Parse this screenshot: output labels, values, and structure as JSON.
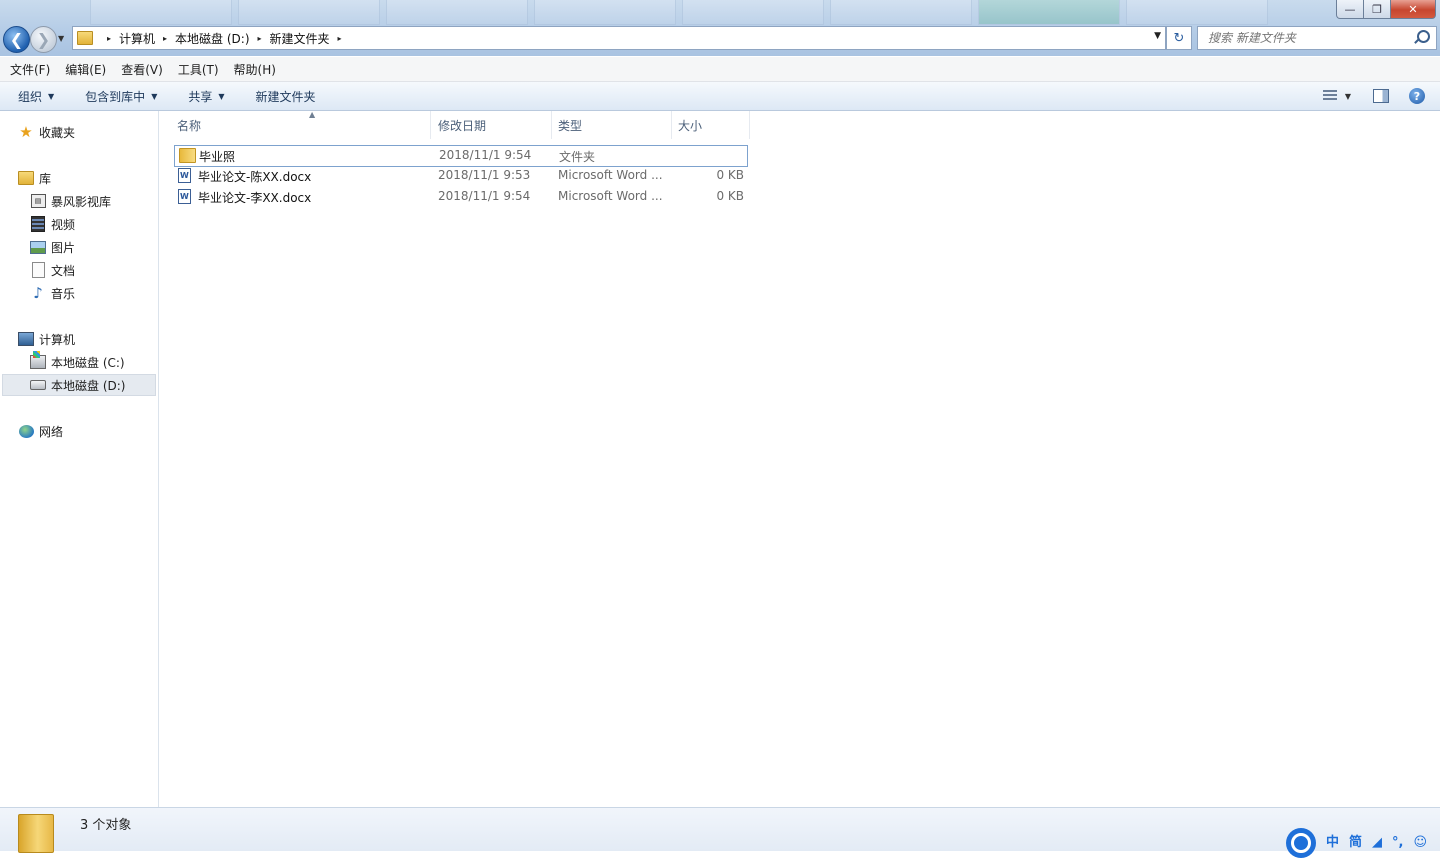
{
  "window": {
    "controls": {
      "minimize": "—",
      "maximize": "❐",
      "close": "✕"
    }
  },
  "nav": {
    "back_glyph": "❮",
    "forward_glyph": "❯",
    "history_glyph": "▼"
  },
  "address": {
    "segments": [
      "计算机",
      "本地磁盘 (D:)",
      "新建文件夹"
    ],
    "separator": "▸",
    "dropdown_glyph": "▼",
    "refresh_glyph": "↻"
  },
  "search": {
    "placeholder": "搜索 新建文件夹"
  },
  "menu": [
    "文件(F)",
    "编辑(E)",
    "查看(V)",
    "工具(T)",
    "帮助(H)"
  ],
  "toolbar": {
    "organize": "组织",
    "include_in_library": "包含到库中",
    "share": "共享",
    "new_folder": "新建文件夹",
    "caret": "▼",
    "help_glyph": "?"
  },
  "sidebar": {
    "favorites": "收藏夹",
    "libraries": "库",
    "library_items": [
      "暴风影视库",
      "视频",
      "图片",
      "文档",
      "音乐"
    ],
    "computer": "计算机",
    "drives": [
      "本地磁盘 (C:)",
      "本地磁盘 (D:)"
    ],
    "selected_drive": "本地磁盘 (D:)",
    "network": "网络"
  },
  "columns": {
    "name": "名称",
    "date": "修改日期",
    "type": "类型",
    "size": "大小",
    "sort_arrow": "▲"
  },
  "files": [
    {
      "name": "毕业照",
      "date": "2018/11/1 9:54",
      "type": "文件夹",
      "size": "",
      "icon": "folder-icon"
    },
    {
      "name": "毕业论文-陈XX.docx",
      "date": "2018/11/1 9:53",
      "type": "Microsoft Word ...",
      "size": "0 KB",
      "icon": "word-icon"
    },
    {
      "name": "毕业论文-李XX.docx",
      "date": "2018/11/1 9:54",
      "type": "Microsoft Word ...",
      "size": "0 KB",
      "icon": "word-icon"
    }
  ],
  "status": {
    "count_text": "3 个对象"
  },
  "ime": {
    "items": [
      "中",
      "简",
      "◢",
      "°,",
      "☺"
    ]
  },
  "colors": {
    "accent": "#1e6fd9",
    "selection_border": "#7da2ce",
    "toolbar_text": "#1e395b"
  }
}
